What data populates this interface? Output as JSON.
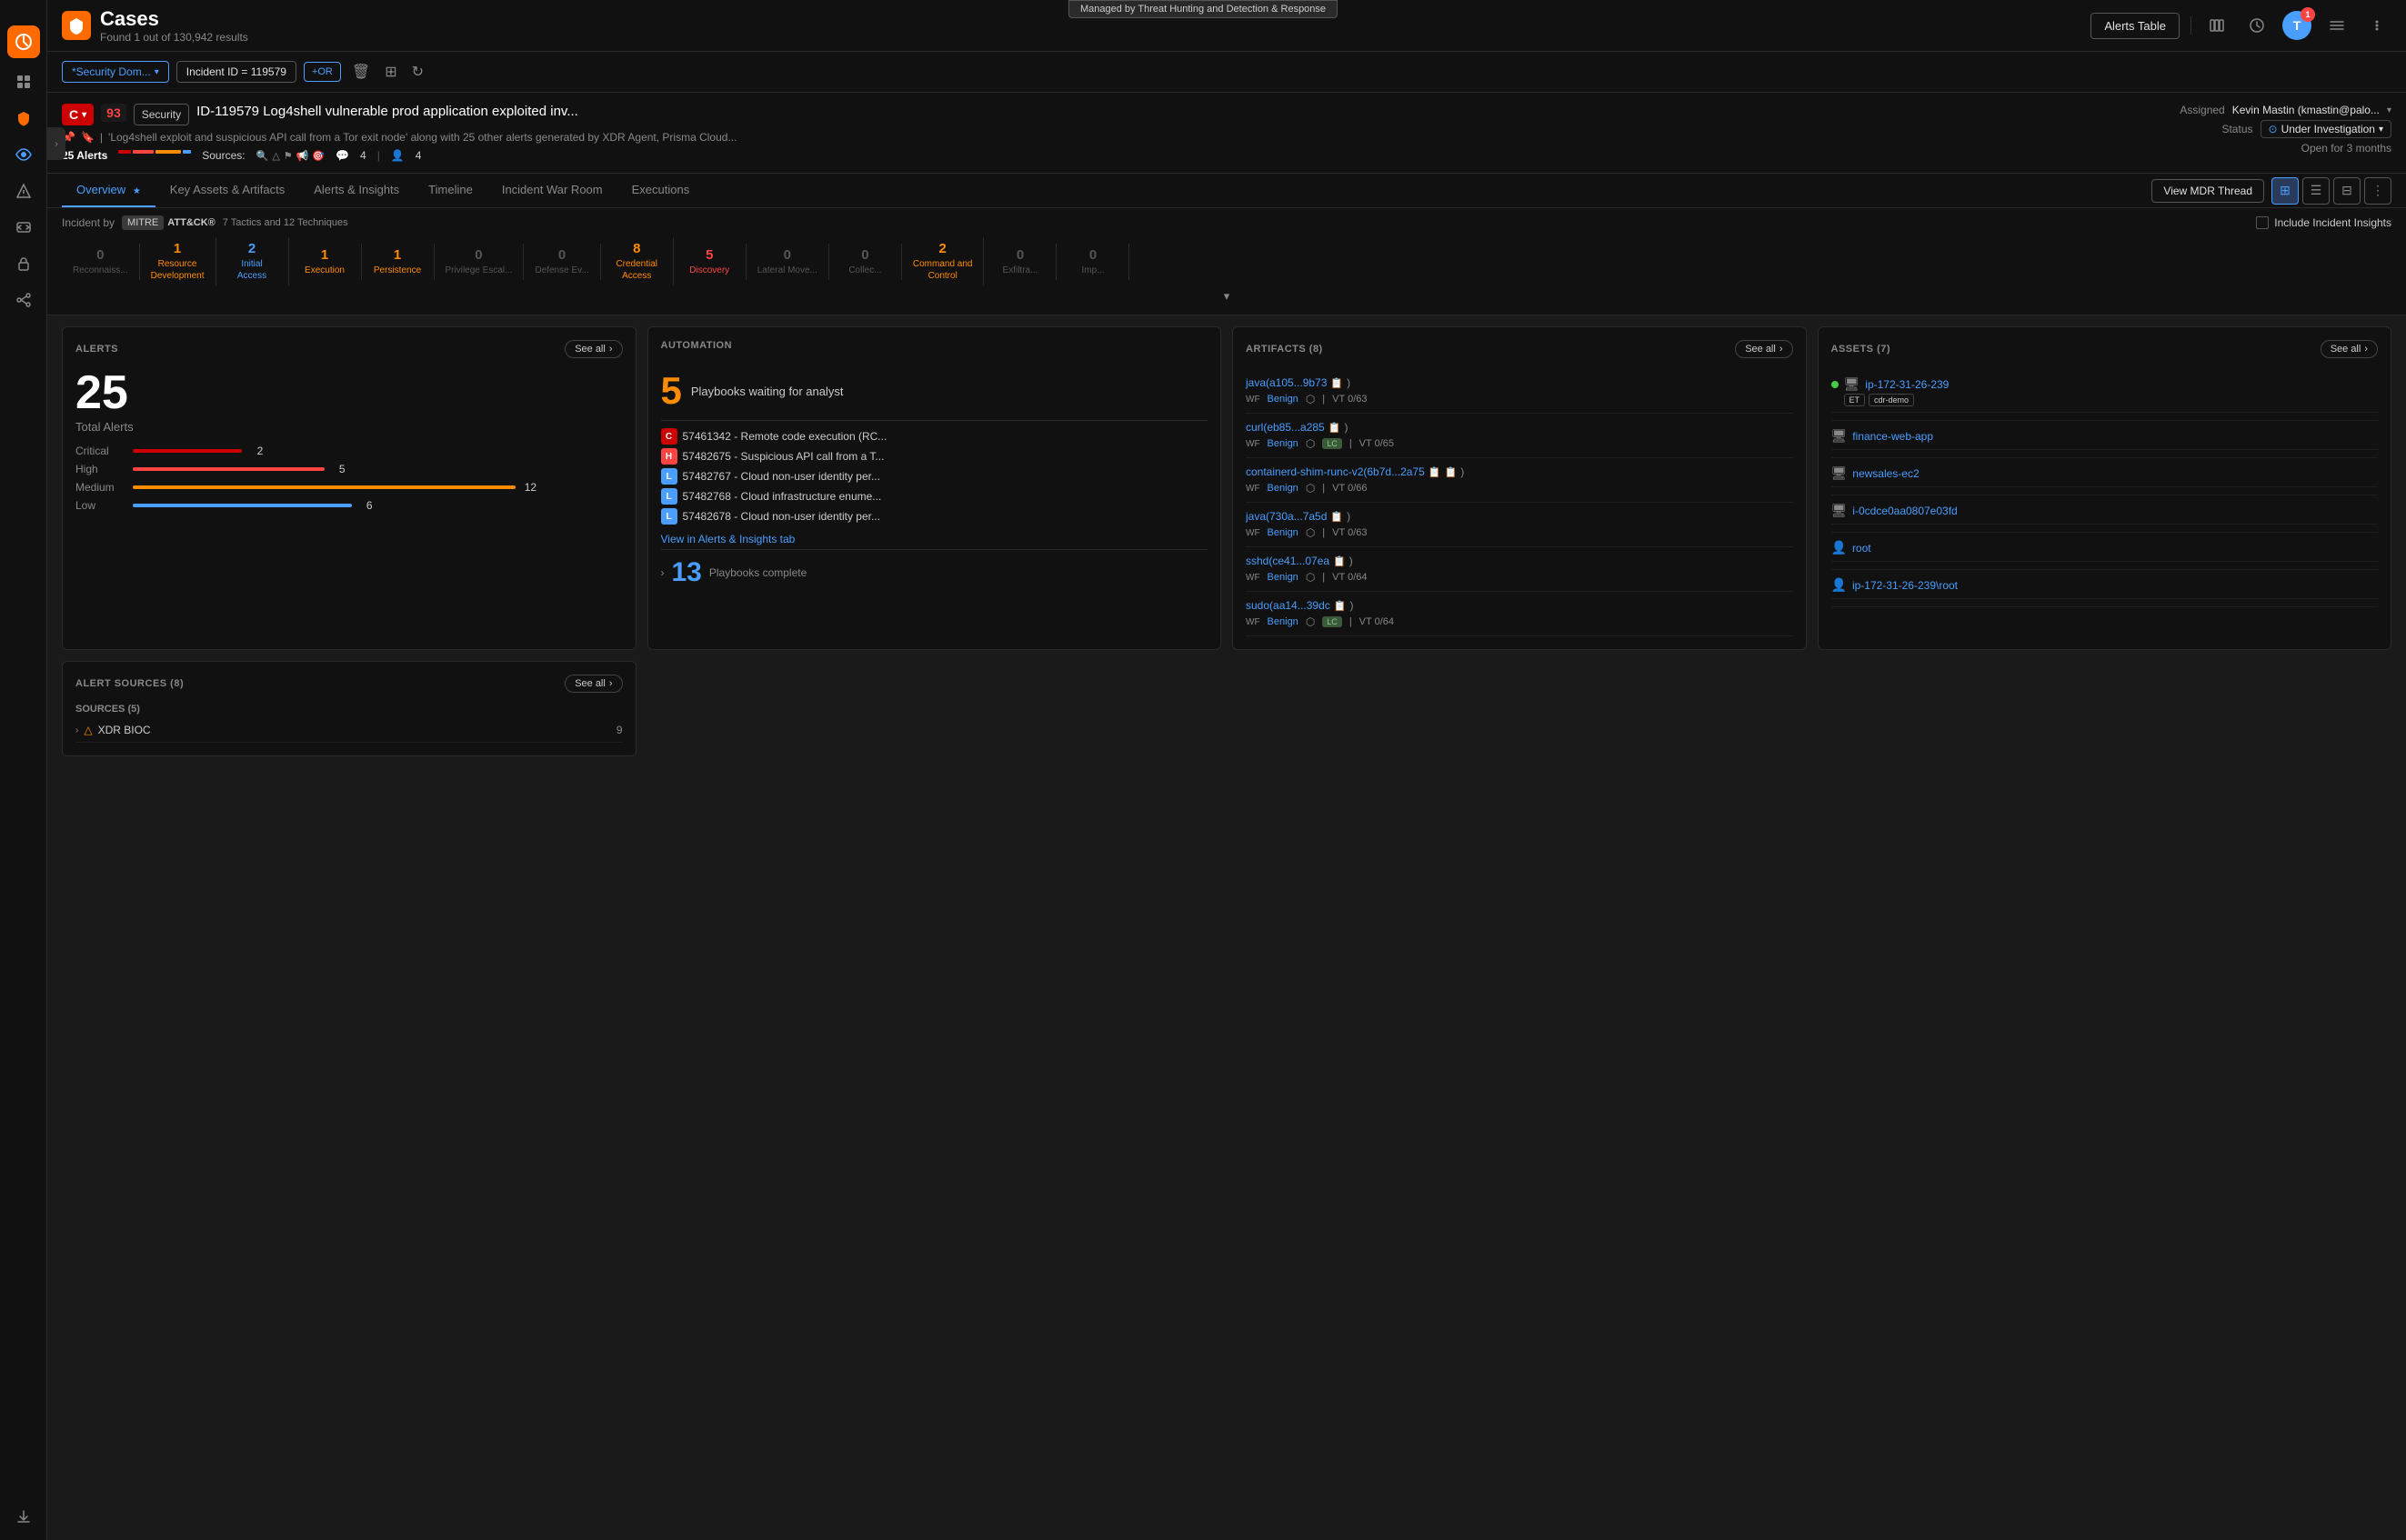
{
  "banner": {
    "text": "Managed by Threat Hunting and Detection & Response"
  },
  "topbar": {
    "title": "Cases",
    "subtitle": "Found 1 out of 130,942 results",
    "alerts_table_btn": "Alerts Table"
  },
  "filters": {
    "filter1": "*Security Dom...",
    "filter2": "Incident ID = 119579",
    "or_btn": "+OR"
  },
  "incident": {
    "severity": "C",
    "score": "93",
    "security_label": "Security",
    "title": "ID-119579 Log4shell vulnerable prod application exploited inv...",
    "meta": "'Log4shell exploit and suspicious API call from a Tor exit node' along with 25 other alerts generated by XDR Agent, Prisma Cloud...",
    "alerts_count": "25 Alerts",
    "sources_label": "Sources:",
    "icon_count1": "4",
    "icon_count2": "4",
    "assigned_label": "Assigned",
    "assigned_value": "Kevin Mastin (kmastin@palo...",
    "status_label": "Status",
    "status_value": "Under Investigation",
    "open_duration": "Open for 3 months"
  },
  "tabs": [
    {
      "id": "overview",
      "label": "Overview",
      "active": true,
      "star": true
    },
    {
      "id": "key-assets",
      "label": "Key Assets & Artifacts",
      "active": false
    },
    {
      "id": "alerts-insights",
      "label": "Alerts & Insights",
      "active": false
    },
    {
      "id": "timeline",
      "label": "Timeline",
      "active": false
    },
    {
      "id": "incident-war-room",
      "label": "Incident War Room",
      "active": false
    },
    {
      "id": "executions",
      "label": "Executions",
      "active": false
    }
  ],
  "view_mdr_btn": "View MDR Thread",
  "mitre": {
    "label": "Incident by",
    "brand": "MITRE",
    "framework": "ATT&CK®",
    "tactics_count": "7 Tactics and 12 Techniques",
    "include_insights": "Include Incident Insights",
    "tactics": [
      {
        "id": "recon",
        "count": "0",
        "name": "Reconnaiss...",
        "color": "zero"
      },
      {
        "id": "resource-dev",
        "count": "1",
        "name": "Resource\nDevelopment",
        "color": "orange"
      },
      {
        "id": "initial-access",
        "count": "2",
        "name": "Initial\nAccess",
        "color": "blue"
      },
      {
        "id": "execution",
        "count": "1",
        "name": "Execution",
        "color": "orange"
      },
      {
        "id": "persistence",
        "count": "1",
        "name": "Persistence",
        "color": "orange"
      },
      {
        "id": "privilege-esc",
        "count": "0",
        "name": "Privilege Escal...",
        "color": "zero"
      },
      {
        "id": "defense-ev",
        "count": "0",
        "name": "Defense Ev...",
        "color": "zero"
      },
      {
        "id": "credential-access",
        "count": "8",
        "name": "Credential\nAccess",
        "color": "orange"
      },
      {
        "id": "discovery",
        "count": "5",
        "name": "Discovery",
        "color": "red"
      },
      {
        "id": "lateral-move",
        "count": "0",
        "name": "Lateral Move...",
        "color": "zero"
      },
      {
        "id": "collection",
        "count": "0",
        "name": "Collec...",
        "color": "zero"
      },
      {
        "id": "command-control",
        "count": "2",
        "name": "Command and\nControl",
        "color": "orange"
      },
      {
        "id": "exfiltration",
        "count": "0",
        "name": "Exfiltra...",
        "color": "zero"
      },
      {
        "id": "impact",
        "count": "0",
        "name": "Imp...",
        "color": "zero"
      }
    ]
  },
  "alerts_panel": {
    "title": "ALERTS",
    "see_all": "See all",
    "total": "25",
    "total_label": "Total Alerts",
    "rows": [
      {
        "label": "Critical",
        "count": "2",
        "color": "#cc0000",
        "width": "20%"
      },
      {
        "label": "High",
        "count": "5",
        "color": "#ff4444",
        "width": "35%"
      },
      {
        "label": "Medium",
        "count": "12",
        "color": "#ff8c00",
        "width": "70%"
      },
      {
        "label": "Low",
        "count": "6",
        "color": "#4a9eff",
        "width": "40%"
      }
    ]
  },
  "automation_panel": {
    "title": "AUTOMATION",
    "waiting_count": "5",
    "waiting_label": "Playbooks waiting for analyst",
    "playbooks": [
      {
        "badge": "C",
        "badge_type": "c",
        "text": "57461342 - Remote code execution (RC..."
      },
      {
        "badge": "H",
        "badge_type": "h",
        "text": "57482675 - Suspicious API call from a T..."
      },
      {
        "badge": "L",
        "badge_type": "l",
        "text": "57482767 - Cloud non-user identity per..."
      },
      {
        "badge": "L",
        "badge_type": "l",
        "text": "57482768 - Cloud infrastructure enume..."
      },
      {
        "badge": "L",
        "badge_type": "l",
        "text": "57482678 - Cloud non-user identity per..."
      }
    ],
    "view_insights": "View in Alerts & Insights tab",
    "complete_count": "13",
    "complete_label": "Playbooks complete"
  },
  "artifacts_panel": {
    "title": "ARTIFACTS (8)",
    "see_all": "See all",
    "items": [
      {
        "name": "java(a105...9b73",
        "wf": "Benign",
        "vt": "VT 0/63",
        "has_lc": false
      },
      {
        "name": "curl(eb85...a285",
        "wf": "Benign",
        "vt": "VT 0/65",
        "has_lc": true
      },
      {
        "name": "containerd-shim-runc-v2(6b7d...2a75",
        "wf": "Benign",
        "vt": "VT 0/66",
        "has_lc": false
      },
      {
        "name": "java(730a...7a5d",
        "wf": "Benign",
        "vt": "VT 0/63",
        "has_lc": false
      },
      {
        "name": "sshd(ce41...07ea",
        "wf": "Benign",
        "vt": "VT 0/64",
        "has_lc": false
      },
      {
        "name": "sudo(aa14...39dc",
        "wf": "Benign",
        "vt": "VT 0/64",
        "has_lc": true
      }
    ]
  },
  "assets_panel": {
    "title": "ASSETS (7)",
    "see_all": "See all",
    "items": [
      {
        "name": "ip-172-31-26-239",
        "type": "server",
        "tags": [
          "ET",
          "cdr-demo"
        ],
        "status": "green"
      },
      {
        "name": "finance-web-app",
        "type": "app",
        "tags": [],
        "status": "gray"
      },
      {
        "name": "newsales-ec2",
        "type": "server",
        "tags": [],
        "status": "gray"
      },
      {
        "name": "i-0cdce0aa0807e03fd",
        "type": "server",
        "tags": [],
        "status": "gray"
      },
      {
        "name": "root",
        "type": "user",
        "tags": [],
        "status": "gray"
      },
      {
        "name": "ip-172-31-26-239\\root",
        "type": "user",
        "tags": [],
        "status": "gray"
      }
    ]
  },
  "alert_sources_panel": {
    "title": "ALERT SOURCES (8)",
    "see_all": "See all",
    "sources_label": "SOURCES (5)",
    "items": [
      {
        "name": "XDR BIOC",
        "count": "9"
      }
    ]
  },
  "sidebar": {
    "items": [
      {
        "id": "home",
        "icon": "⊙",
        "active": false
      },
      {
        "id": "shield",
        "icon": "🛡",
        "active": true
      },
      {
        "id": "eye",
        "icon": "👁",
        "active": false
      },
      {
        "id": "alert",
        "icon": "⚠",
        "active": false
      },
      {
        "id": "grid",
        "icon": "⊞",
        "active": false
      },
      {
        "id": "lock",
        "icon": "🔒",
        "active": false
      },
      {
        "id": "graph",
        "icon": "◈",
        "active": false
      },
      {
        "id": "download",
        "icon": "↓",
        "active": false
      }
    ]
  }
}
